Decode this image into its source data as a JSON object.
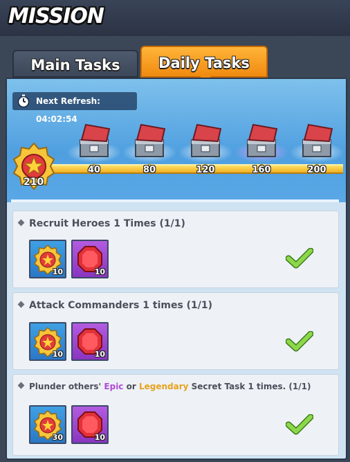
{
  "header": {
    "title": "MISSION"
  },
  "tabs": [
    {
      "label": "Main Tasks",
      "active": false
    },
    {
      "label": "Daily Tasks",
      "active": true
    }
  ],
  "refresh": {
    "label": "Next Refresh: 04:02:54"
  },
  "progress": {
    "points": "210",
    "milestones": [
      "40",
      "80",
      "120",
      "160",
      "200"
    ]
  },
  "tasks": [
    {
      "title": "Recruit Heroes 1 Times (1/1)",
      "rewards": [
        {
          "icon": "medal-icon",
          "count": "10"
        },
        {
          "icon": "ruby-icon",
          "count": "10"
        }
      ],
      "completed": true
    },
    {
      "title": "Attack Commanders 1 times (1/1)",
      "rewards": [
        {
          "icon": "medal-icon",
          "count": "10"
        },
        {
          "icon": "ruby-icon",
          "count": "10"
        }
      ],
      "completed": true
    },
    {
      "title_parts": {
        "a": "Plunder others' ",
        "epic": "Epic",
        "or": " or ",
        "legendary": "Legendary",
        "rest": " Secret Task 1 times. (1/1)"
      },
      "rewards": [
        {
          "icon": "medal-icon",
          "count": "30"
        },
        {
          "icon": "ruby-icon",
          "count": "10"
        }
      ],
      "completed": true
    }
  ],
  "colors": {
    "accent": "#f39a1a",
    "check": "#7cc83a",
    "epic": "#b04bd6",
    "legendary": "#e8a21e"
  }
}
